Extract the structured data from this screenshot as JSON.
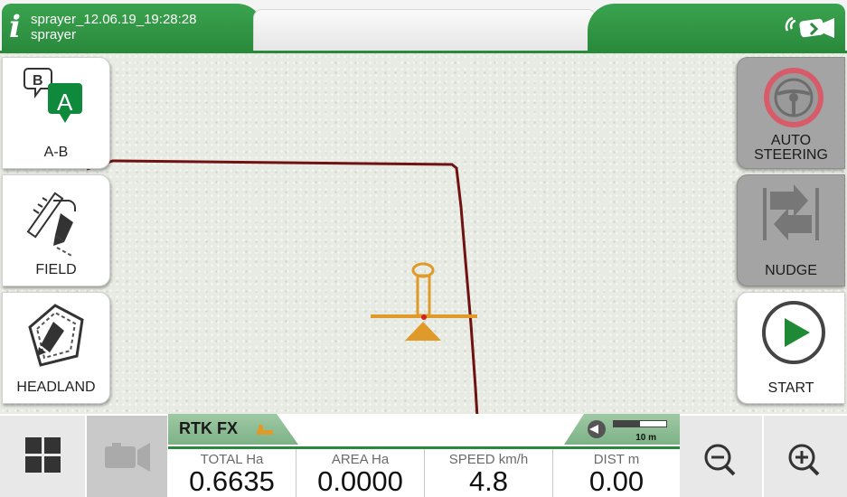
{
  "header": {
    "title_line1": "sprayer_12.06.19_19:28:28",
    "title_line2": "sprayer"
  },
  "left_buttons": [
    {
      "label": "A-B",
      "icon": "ab-line-icon"
    },
    {
      "label": "FIELD",
      "icon": "field-boundary-icon"
    },
    {
      "label": "HEADLAND",
      "icon": "headland-icon"
    }
  ],
  "right_buttons": [
    {
      "label_line1": "AUTO",
      "label_line2": "STEERING",
      "icon": "steering-wheel-icon",
      "state": "disabled"
    },
    {
      "label": "NUDGE",
      "icon": "nudge-icon",
      "state": "disabled"
    },
    {
      "label": "START",
      "icon": "play-icon",
      "state": "enabled"
    }
  ],
  "status": {
    "gps_fix": "RTK FX",
    "scale_label": "10 m"
  },
  "readouts": [
    {
      "header": "TOTAL Ha",
      "value": "0.6635"
    },
    {
      "header": "AREA Ha",
      "value": "0.0000"
    },
    {
      "header": "SPEED km/h",
      "value": "4.8"
    },
    {
      "header": "DIST m",
      "value": "0.00"
    }
  ],
  "colors": {
    "accent": "#2a8a3c",
    "track": "#6e1212",
    "vehicle": "#e09a2a",
    "start_green": "#1e8a35"
  }
}
